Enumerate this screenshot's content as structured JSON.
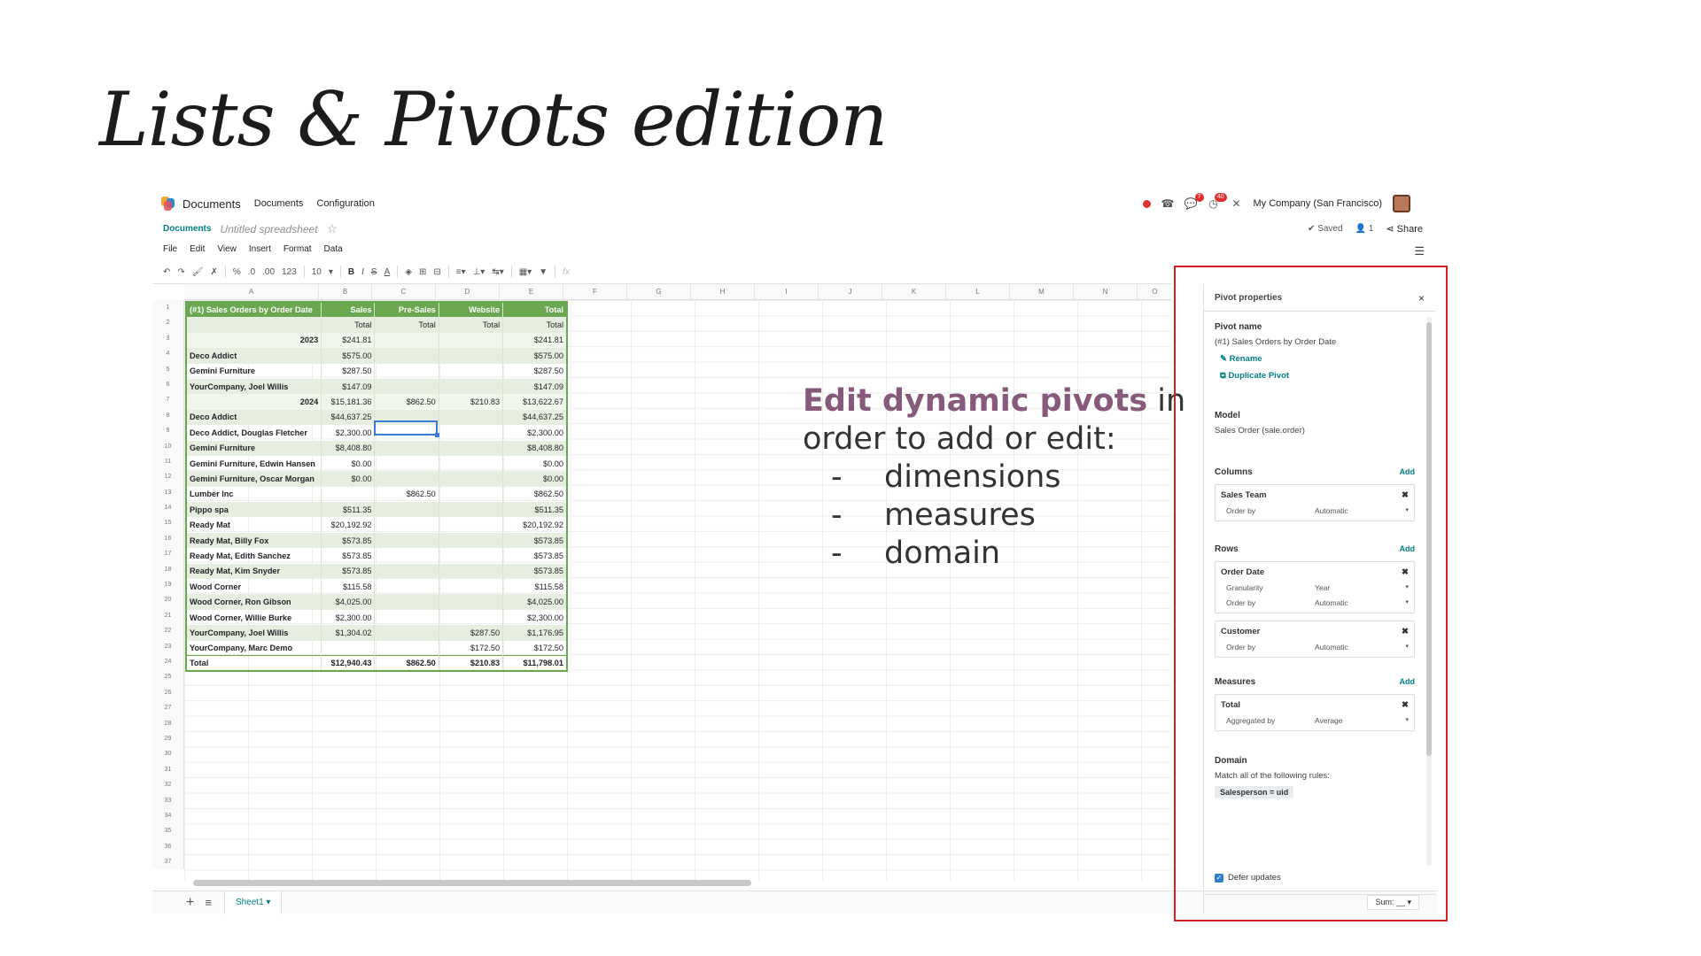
{
  "slide": {
    "title": "Lists & Pivots edition"
  },
  "topnav": {
    "app_name": "Documents",
    "menus": [
      "Documents",
      "Configuration"
    ],
    "company": "My Company (San Francisco)",
    "badges": {
      "chat": "7",
      "activity": "40"
    }
  },
  "breadcrumb": {
    "link": "Documents",
    "doc_name": "Untitled spreadsheet"
  },
  "status": {
    "saved": "✔ Saved",
    "users": "1",
    "share": "Share"
  },
  "menubar": [
    "File",
    "Edit",
    "View",
    "Insert",
    "Format",
    "Data"
  ],
  "toolbar": {
    "percent": "%",
    "decimal_less": ".0",
    "decimal_more": ".00",
    "number_format": "123",
    "font_size": "10",
    "bold": "B",
    "italic": "I",
    "strike": "S",
    "text_color": "A",
    "formula": "fx"
  },
  "grid": {
    "columns": [
      "A",
      "B",
      "C",
      "D",
      "E",
      "F",
      "G",
      "H",
      "I",
      "J",
      "K",
      "L",
      "M",
      "N",
      "O"
    ],
    "rows": [
      "1",
      "2",
      "3",
      "4",
      "5",
      "6",
      "7",
      "8",
      "9",
      "10",
      "11",
      "12",
      "13",
      "14",
      "15",
      "16",
      "17",
      "18",
      "19",
      "20",
      "21",
      "22",
      "23",
      "24",
      "25",
      "26",
      "27",
      "28",
      "29",
      "30",
      "31",
      "32",
      "33",
      "34",
      "35",
      "36",
      "37"
    ]
  },
  "pivot_table": {
    "header": [
      "(#1) Sales Orders by Order Date",
      "Sales",
      "Pre-Sales",
      "Website",
      "Total"
    ],
    "subheader": [
      "",
      "Total",
      "Total",
      "Total",
      "Total"
    ],
    "rows": [
      {
        "type": "yr",
        "cells": [
          "2023",
          "$241.81",
          "",
          "",
          "$241.81"
        ]
      },
      {
        "type": "band",
        "cells": [
          "Deco Addict",
          "$575.00",
          "",
          "",
          "$575.00"
        ]
      },
      {
        "type": "",
        "cells": [
          "Gemini Furniture",
          "$287.50",
          "",
          "",
          "$287.50"
        ]
      },
      {
        "type": "band",
        "cells": [
          "YourCompany, Joel Willis",
          "$147.09",
          "",
          "",
          "$147.09"
        ]
      },
      {
        "type": "yr",
        "cells": [
          "2024",
          "$15,181.36",
          "$862.50",
          "$210.83",
          "$13,622.67"
        ]
      },
      {
        "type": "band",
        "cells": [
          "Deco Addict",
          "$44,637.25",
          "",
          "",
          "$44,637.25"
        ]
      },
      {
        "type": "",
        "cells": [
          "Deco Addict, Douglas Fletcher",
          "$2,300.00",
          "",
          "",
          "$2,300.00"
        ]
      },
      {
        "type": "band",
        "cells": [
          "Gemini Furniture",
          "$8,408.80",
          "",
          "",
          "$8,408.80"
        ]
      },
      {
        "type": "",
        "cells": [
          "Gemini Furniture, Edwin Hansen",
          "$0.00",
          "",
          "",
          "$0.00"
        ]
      },
      {
        "type": "band",
        "cells": [
          "Gemini Furniture, Oscar Morgan",
          "$0.00",
          "",
          "",
          "$0.00"
        ]
      },
      {
        "type": "",
        "cells": [
          "Lumber Inc",
          "",
          "$862.50",
          "",
          "$862.50"
        ]
      },
      {
        "type": "band",
        "cells": [
          "Pippo spa",
          "$511.35",
          "",
          "",
          "$511.35"
        ]
      },
      {
        "type": "",
        "cells": [
          "Ready Mat",
          "$20,192.92",
          "",
          "",
          "$20,192.92"
        ]
      },
      {
        "type": "band",
        "cells": [
          "Ready Mat, Billy Fox",
          "$573.85",
          "",
          "",
          "$573.85"
        ]
      },
      {
        "type": "",
        "cells": [
          "Ready Mat, Edith Sanchez",
          "$573.85",
          "",
          "",
          "$573.85"
        ]
      },
      {
        "type": "band",
        "cells": [
          "Ready Mat, Kim Snyder",
          "$573.85",
          "",
          "",
          "$573.85"
        ]
      },
      {
        "type": "",
        "cells": [
          "Wood Corner",
          "$115.58",
          "",
          "",
          "$115.58"
        ]
      },
      {
        "type": "band",
        "cells": [
          "Wood Corner, Ron Gibson",
          "$4,025.00",
          "",
          "",
          "$4,025.00"
        ]
      },
      {
        "type": "",
        "cells": [
          "Wood Corner, Willie Burke",
          "$2,300.00",
          "",
          "",
          "$2,300.00"
        ]
      },
      {
        "type": "band",
        "cells": [
          "YourCompany, Joel Willis",
          "$1,304.02",
          "",
          "$287.50",
          "$1,176.95"
        ]
      },
      {
        "type": "",
        "cells": [
          "YourCompany, Marc Demo",
          "",
          "",
          "$172.50",
          "$172.50"
        ]
      },
      {
        "type": "total",
        "cells": [
          "Total",
          "$12,940.43",
          "$862.50",
          "$210.83",
          "$11,798.01"
        ]
      }
    ]
  },
  "bottombar": {
    "sheet": "Sheet1",
    "sum": "Sum: __"
  },
  "callout": {
    "emphasis": "Edit dynamic pivots",
    "rest_line1": " in",
    "line2": "order to add or edit:",
    "items": [
      "dimensions",
      "measures",
      "domain"
    ]
  },
  "panel": {
    "title": "Pivot properties",
    "pivot_name_label": "Pivot name",
    "pivot_name": "(#1) Sales Orders by Order Date",
    "rename": "Rename",
    "duplicate": "Duplicate Pivot",
    "model_label": "Model",
    "model": "Sales Order (sale.order)",
    "add_label": "Add",
    "columns_label": "Columns",
    "columns": [
      {
        "name": "Sales Team",
        "options": [
          {
            "k": "Order by",
            "v": "Automatic"
          }
        ]
      }
    ],
    "rows_label": "Rows",
    "rows": [
      {
        "name": "Order Date",
        "options": [
          {
            "k": "Granularity",
            "v": "Year"
          },
          {
            "k": "Order by",
            "v": "Automatic"
          }
        ]
      },
      {
        "name": "Customer",
        "options": [
          {
            "k": "Order by",
            "v": "Automatic"
          }
        ]
      }
    ],
    "measures_label": "Measures",
    "measures": [
      {
        "name": "Total",
        "options": [
          {
            "k": "Aggregated by",
            "v": "Average"
          }
        ]
      }
    ],
    "domain_label": "Domain",
    "domain_text": "Match all of the following rules:",
    "domain_rule": "Salesperson = uid",
    "defer": "Defer updates"
  }
}
